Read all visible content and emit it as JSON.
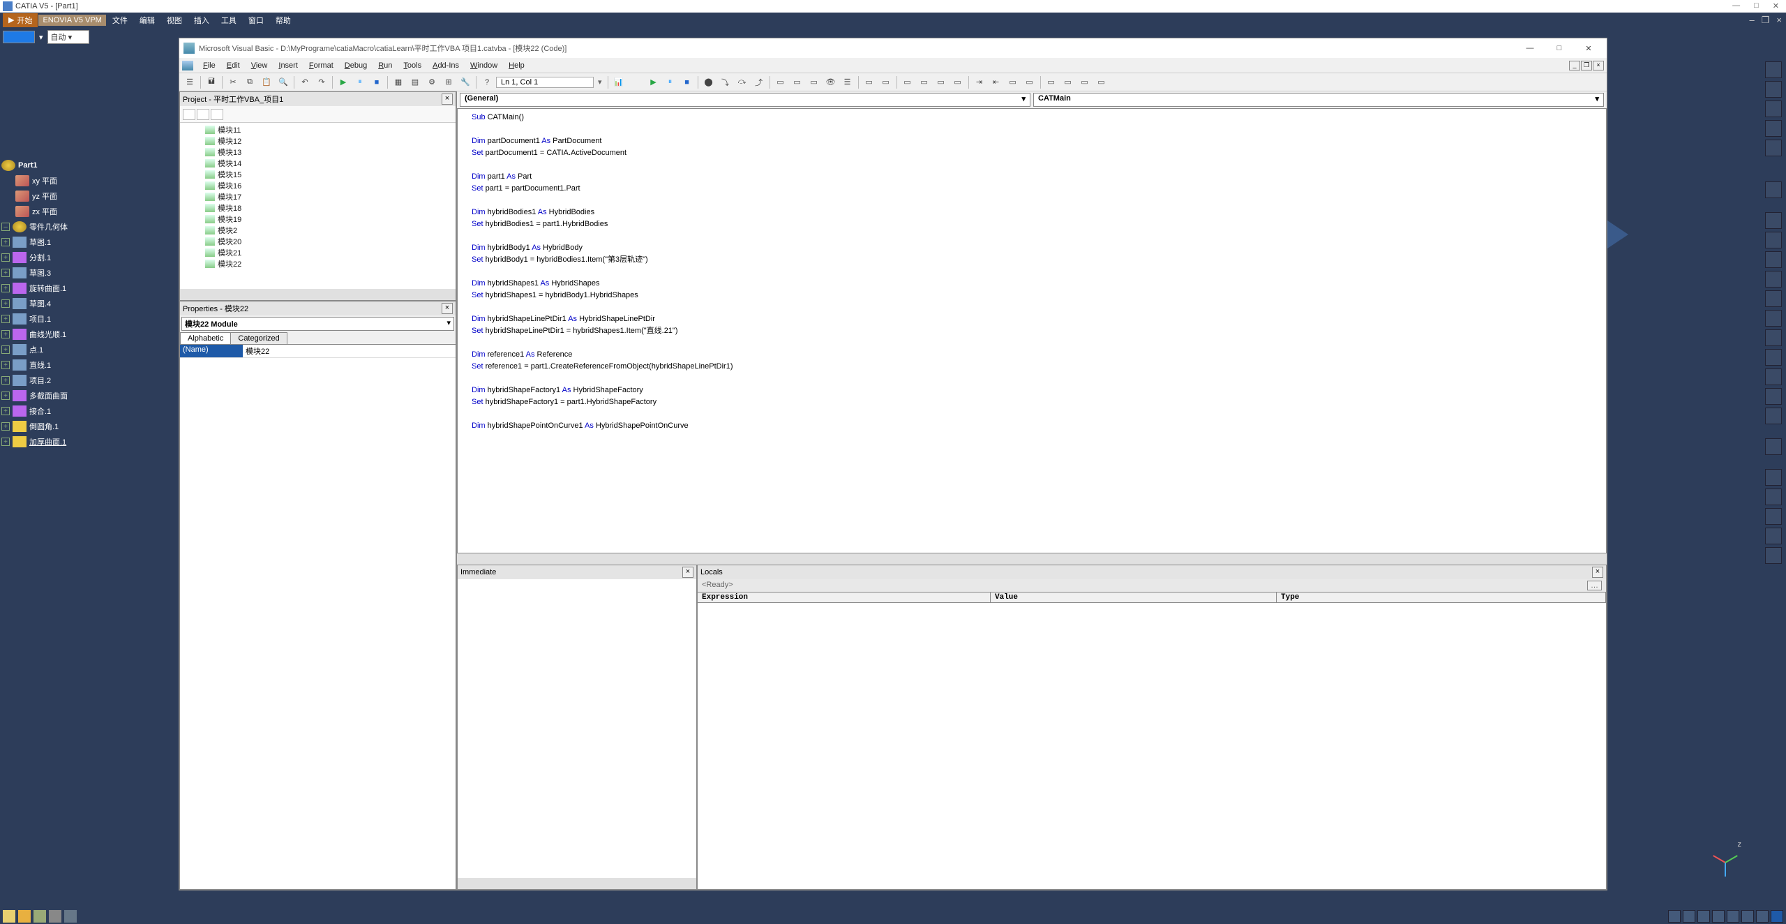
{
  "catia": {
    "title": "CATIA V5 - [Part1]",
    "menu": {
      "start": "开始",
      "enovia": "ENOVIA V5 VPM",
      "file": "文件",
      "edit": "编辑",
      "view": "视图",
      "insert": "插入",
      "tools": "工具",
      "window": "窗口",
      "help": "帮助"
    },
    "combo_value": "自动",
    "tree": {
      "root": "Part1",
      "xy": "xy 平面",
      "yz": "yz 平面",
      "zx": "zx 平面",
      "body": "零件几何体",
      "items": [
        "草图.1",
        "分割.1",
        "草图.3",
        "旋转曲面.1",
        "草图.4",
        "项目.1",
        "曲线光顺.1",
        "点.1",
        "直线.1",
        "项目.2",
        "多截面曲面",
        "接合.1",
        "倒圆角.1",
        "加厚曲面.1"
      ]
    },
    "compass_z": "z"
  },
  "vba": {
    "title": "Microsoft Visual Basic - D:\\MyPrograme\\catiaMacro\\catiaLearn\\平时工作VBA 项目1.catvba - [模块22 (Code)]",
    "menu": [
      "File",
      "Edit",
      "View",
      "Insert",
      "Format",
      "Debug",
      "Run",
      "Tools",
      "Add-Ins",
      "Window",
      "Help"
    ],
    "lncol": "Ln 1, Col 1",
    "project": {
      "title": "Project - 平时工作VBA_项目1",
      "modules": [
        "模块11",
        "模块12",
        "模块13",
        "模块14",
        "模块15",
        "模块16",
        "模块17",
        "模块18",
        "模块19",
        "模块2",
        "模块20",
        "模块21",
        "模块22"
      ]
    },
    "props": {
      "title": "Properties - 模块22",
      "object": "模块22 Module",
      "tab_alpha": "Alphabetic",
      "tab_cat": "Categorized",
      "name_label": "(Name)",
      "name_value": "模块22"
    },
    "combos": {
      "left": "(General)",
      "right": "CATMain"
    },
    "code_lines": [
      {
        "t": "Sub CATMain()",
        "k": [
          "Sub"
        ]
      },
      {
        "t": ""
      },
      {
        "t": "Dim partDocument1 As PartDocument",
        "k": [
          "Dim",
          "As"
        ]
      },
      {
        "t": "Set partDocument1 = CATIA.ActiveDocument",
        "k": [
          "Set"
        ]
      },
      {
        "t": ""
      },
      {
        "t": "Dim part1 As Part",
        "k": [
          "Dim",
          "As"
        ]
      },
      {
        "t": "Set part1 = partDocument1.Part",
        "k": [
          "Set"
        ]
      },
      {
        "t": ""
      },
      {
        "t": "Dim hybridBodies1 As HybridBodies",
        "k": [
          "Dim",
          "As"
        ]
      },
      {
        "t": "Set hybridBodies1 = part1.HybridBodies",
        "k": [
          "Set"
        ]
      },
      {
        "t": ""
      },
      {
        "t": "Dim hybridBody1 As HybridBody",
        "k": [
          "Dim",
          "As"
        ]
      },
      {
        "t": "Set hybridBody1 = hybridBodies1.Item(\"第3层轨迹\")",
        "k": [
          "Set"
        ]
      },
      {
        "t": ""
      },
      {
        "t": "Dim hybridShapes1 As HybridShapes",
        "k": [
          "Dim",
          "As"
        ]
      },
      {
        "t": "Set hybridShapes1 = hybridBody1.HybridShapes",
        "k": [
          "Set"
        ]
      },
      {
        "t": ""
      },
      {
        "t": "Dim hybridShapeLinePtDir1 As HybridShapeLinePtDir",
        "k": [
          "Dim",
          "As"
        ]
      },
      {
        "t": "Set hybridShapeLinePtDir1 = hybridShapes1.Item(\"直线.21\")",
        "k": [
          "Set"
        ]
      },
      {
        "t": ""
      },
      {
        "t": "Dim reference1 As Reference",
        "k": [
          "Dim",
          "As"
        ]
      },
      {
        "t": "Set reference1 = part1.CreateReferenceFromObject(hybridShapeLinePtDir1)",
        "k": [
          "Set"
        ]
      },
      {
        "t": ""
      },
      {
        "t": "Dim hybridShapeFactory1 As HybridShapeFactory",
        "k": [
          "Dim",
          "As"
        ]
      },
      {
        "t": "Set hybridShapeFactory1 = part1.HybridShapeFactory",
        "k": [
          "Set"
        ]
      },
      {
        "t": ""
      },
      {
        "t": "Dim hybridShapePointOnCurve1 As HybridShapePointOnCurve",
        "k": [
          "Dim",
          "As"
        ]
      }
    ],
    "immediate": {
      "title": "Immediate"
    },
    "locals": {
      "title": "Locals",
      "ready": "<Ready>",
      "cols": [
        "Expression",
        "Value",
        "Type"
      ]
    }
  }
}
